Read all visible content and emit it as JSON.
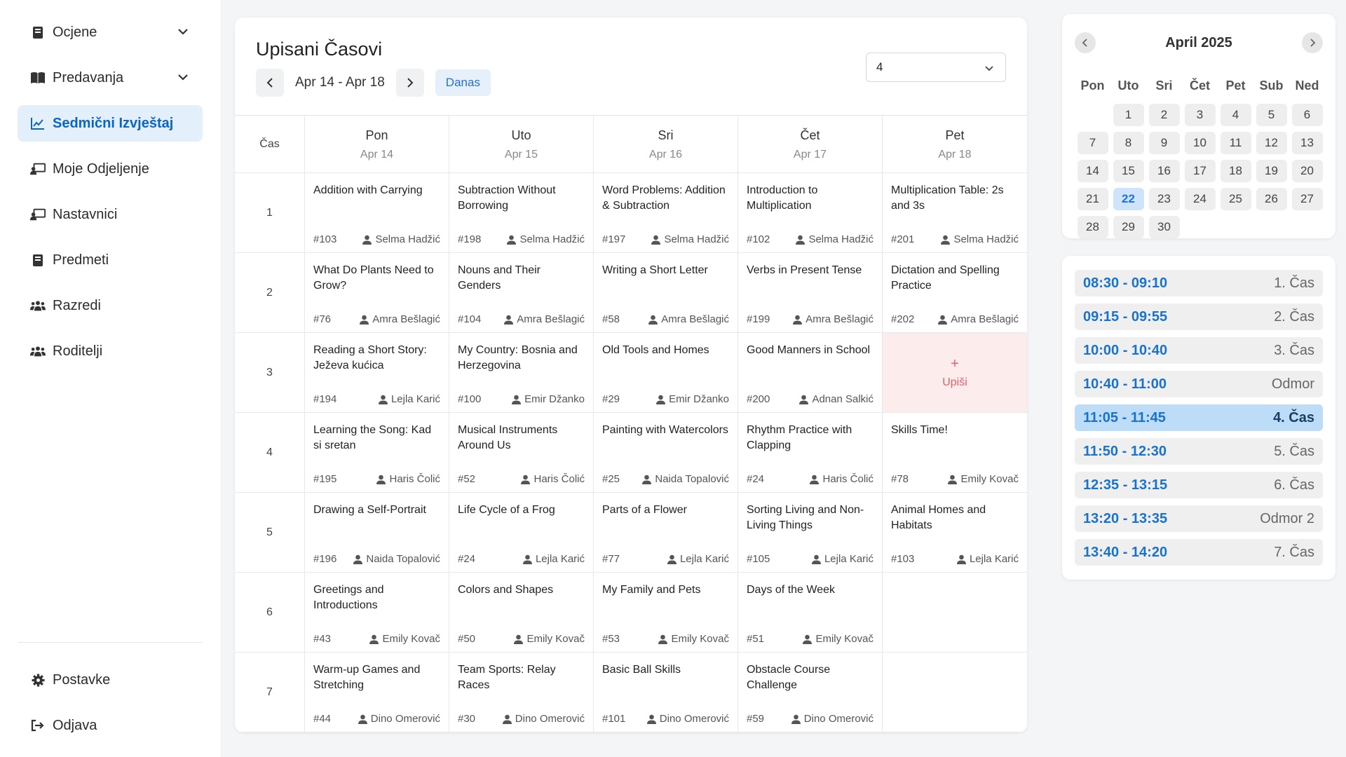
{
  "sidebar": {
    "items": [
      {
        "label": "Ocjene",
        "icon": "book-icon"
      },
      {
        "label": "Predavanja",
        "icon": "open-book-icon"
      },
      {
        "label": "Sedmični Izvještaj",
        "icon": "chart-line-icon"
      },
      {
        "label": "Moje Odjeljenje",
        "icon": "chalkboard-teacher-icon"
      },
      {
        "label": "Nastavnici",
        "icon": "chalkboard-teacher-icon"
      },
      {
        "label": "Predmeti",
        "icon": "book-icon"
      },
      {
        "label": "Razredi",
        "icon": "users-icon"
      },
      {
        "label": "Roditelji",
        "icon": "users-icon"
      }
    ],
    "bottom": [
      {
        "label": "Postavke",
        "icon": "gear-icon"
      },
      {
        "label": "Odjava",
        "icon": "sign-out-icon"
      }
    ]
  },
  "schedule": {
    "title": "Upisani Časovi",
    "range": "Apr 14 - Apr 18",
    "today_label": "Danas",
    "select_value": "4",
    "cas_header": "Čas",
    "days": [
      {
        "name": "Pon",
        "date": "Apr 14"
      },
      {
        "name": "Uto",
        "date": "Apr 15"
      },
      {
        "name": "Sri",
        "date": "Apr 16"
      },
      {
        "name": "Čet",
        "date": "Apr 17"
      },
      {
        "name": "Pet",
        "date": "Apr 18"
      }
    ],
    "rows": [
      {
        "period": "1",
        "cells": [
          {
            "title": "Addition with Carrying",
            "id": "#103",
            "teacher": "Selma Hadžić"
          },
          {
            "title": "Subtraction Without Borrowing",
            "id": "#198",
            "teacher": "Selma Hadžić"
          },
          {
            "title": "Word Problems: Addition & Subtraction",
            "id": "#197",
            "teacher": "Selma Hadžić"
          },
          {
            "title": "Introduction to Multiplication",
            "id": "#102",
            "teacher": "Selma Hadžić"
          },
          {
            "title": "Multiplication Table: 2s and 3s",
            "id": "#201",
            "teacher": "Selma Hadžić"
          }
        ]
      },
      {
        "period": "2",
        "cells": [
          {
            "title": "What Do Plants Need to Grow?",
            "id": "#76",
            "teacher": "Amra Bešlagić"
          },
          {
            "title": "Nouns and Their Genders",
            "id": "#104",
            "teacher": "Amra Bešlagić"
          },
          {
            "title": "Writing a Short Letter",
            "id": "#58",
            "teacher": "Amra Bešlagić"
          },
          {
            "title": "Verbs in Present Tense",
            "id": "#199",
            "teacher": "Amra Bešlagić"
          },
          {
            "title": "Dictation and Spelling Practice",
            "id": "#202",
            "teacher": "Amra Bešlagić"
          }
        ]
      },
      {
        "period": "3",
        "cells": [
          {
            "title": "Reading a Short Story: Ježeva kućica",
            "id": "#194",
            "teacher": "Lejla Karić"
          },
          {
            "title": "My Country: Bosnia and Herzegovina",
            "id": "#100",
            "teacher": "Emir Džanko"
          },
          {
            "title": "Old Tools and Homes",
            "id": "#29",
            "teacher": "Emir Džanko"
          },
          {
            "title": "Good Manners in School",
            "id": "#200",
            "teacher": "Adnan Salkić"
          },
          {
            "empty_action": "Upiši",
            "plus": "+"
          }
        ]
      },
      {
        "period": "4",
        "cells": [
          {
            "title": "Learning the Song: Kad si sretan",
            "id": "#195",
            "teacher": "Haris Čolić"
          },
          {
            "title": "Musical Instruments Around Us",
            "id": "#52",
            "teacher": "Haris Čolić"
          },
          {
            "title": "Painting with Watercolors",
            "id": "#25",
            "teacher": "Naida Topalović"
          },
          {
            "title": "Rhythm Practice with Clapping",
            "id": "#24",
            "teacher": "Haris Čolić"
          },
          {
            "title": "Skills Time!",
            "id": "#78",
            "teacher": "Emily Kovač"
          }
        ]
      },
      {
        "period": "5",
        "cells": [
          {
            "title": "Drawing a Self-Portrait",
            "id": "#196",
            "teacher": "Naida Topalović"
          },
          {
            "title": "Life Cycle of a Frog",
            "id": "#24",
            "teacher": "Lejla Karić"
          },
          {
            "title": "Parts of a Flower",
            "id": "#77",
            "teacher": "Lejla Karić"
          },
          {
            "title": "Sorting Living and Non-Living Things",
            "id": "#105",
            "teacher": "Lejla Karić"
          },
          {
            "title": "Animal Homes and Habitats",
            "id": "#103",
            "teacher": "Lejla Karić"
          }
        ]
      },
      {
        "period": "6",
        "cells": [
          {
            "title": "Greetings and Introductions",
            "id": "#43",
            "teacher": "Emily Kovač"
          },
          {
            "title": "Colors and Shapes",
            "id": "#50",
            "teacher": "Emily Kovač"
          },
          {
            "title": "My Family and Pets",
            "id": "#53",
            "teacher": "Emily Kovač"
          },
          {
            "title": "Days of the Week",
            "id": "#51",
            "teacher": "Emily Kovač"
          },
          {}
        ]
      },
      {
        "period": "7",
        "cells": [
          {
            "title": "Warm-up Games and Stretching",
            "id": "#44",
            "teacher": "Dino Omerović"
          },
          {
            "title": "Team Sports: Relay Races",
            "id": "#30",
            "teacher": "Dino Omerović"
          },
          {
            "title": "Basic Ball Skills",
            "id": "#101",
            "teacher": "Dino Omerović"
          },
          {
            "title": "Obstacle Course Challenge",
            "id": "#59",
            "teacher": "Dino Omerović"
          },
          {}
        ]
      }
    ]
  },
  "calendar": {
    "month": "April 2025",
    "weekdays": [
      "Pon",
      "Uto",
      "Sri",
      "Čet",
      "Pet",
      "Sub",
      "Ned"
    ],
    "leading_blanks": 1,
    "days": [
      "1",
      "2",
      "3",
      "4",
      "5",
      "6",
      "7",
      "8",
      "9",
      "10",
      "11",
      "12",
      "13",
      "14",
      "15",
      "16",
      "17",
      "18",
      "19",
      "20",
      "21",
      "22",
      "23",
      "24",
      "25",
      "26",
      "27",
      "28",
      "29",
      "30"
    ],
    "today": "22"
  },
  "times": [
    {
      "time": "08:30 - 09:10",
      "label": "1. Čas",
      "active": false
    },
    {
      "time": "09:15 - 09:55",
      "label": "2. Čas",
      "active": false
    },
    {
      "time": "10:00 - 10:40",
      "label": "3. Čas",
      "active": false
    },
    {
      "time": "10:40 - 11:00",
      "label": "Odmor",
      "active": false
    },
    {
      "time": "11:05 - 11:45",
      "label": "4. Čas",
      "active": true
    },
    {
      "time": "11:50 - 12:30",
      "label": "5. Čas",
      "active": false
    },
    {
      "time": "12:35 - 13:15",
      "label": "6. Čas",
      "active": false
    },
    {
      "time": "13:20 - 13:35",
      "label": "Odmor 2",
      "active": false
    },
    {
      "time": "13:40 - 14:20",
      "label": "7. Čas",
      "active": false
    }
  ],
  "colors": {
    "accent": "#0a66c2",
    "active_bg": "#e3effb",
    "upisi_bg": "#fdecec",
    "upisi_text": "#e0616a"
  }
}
